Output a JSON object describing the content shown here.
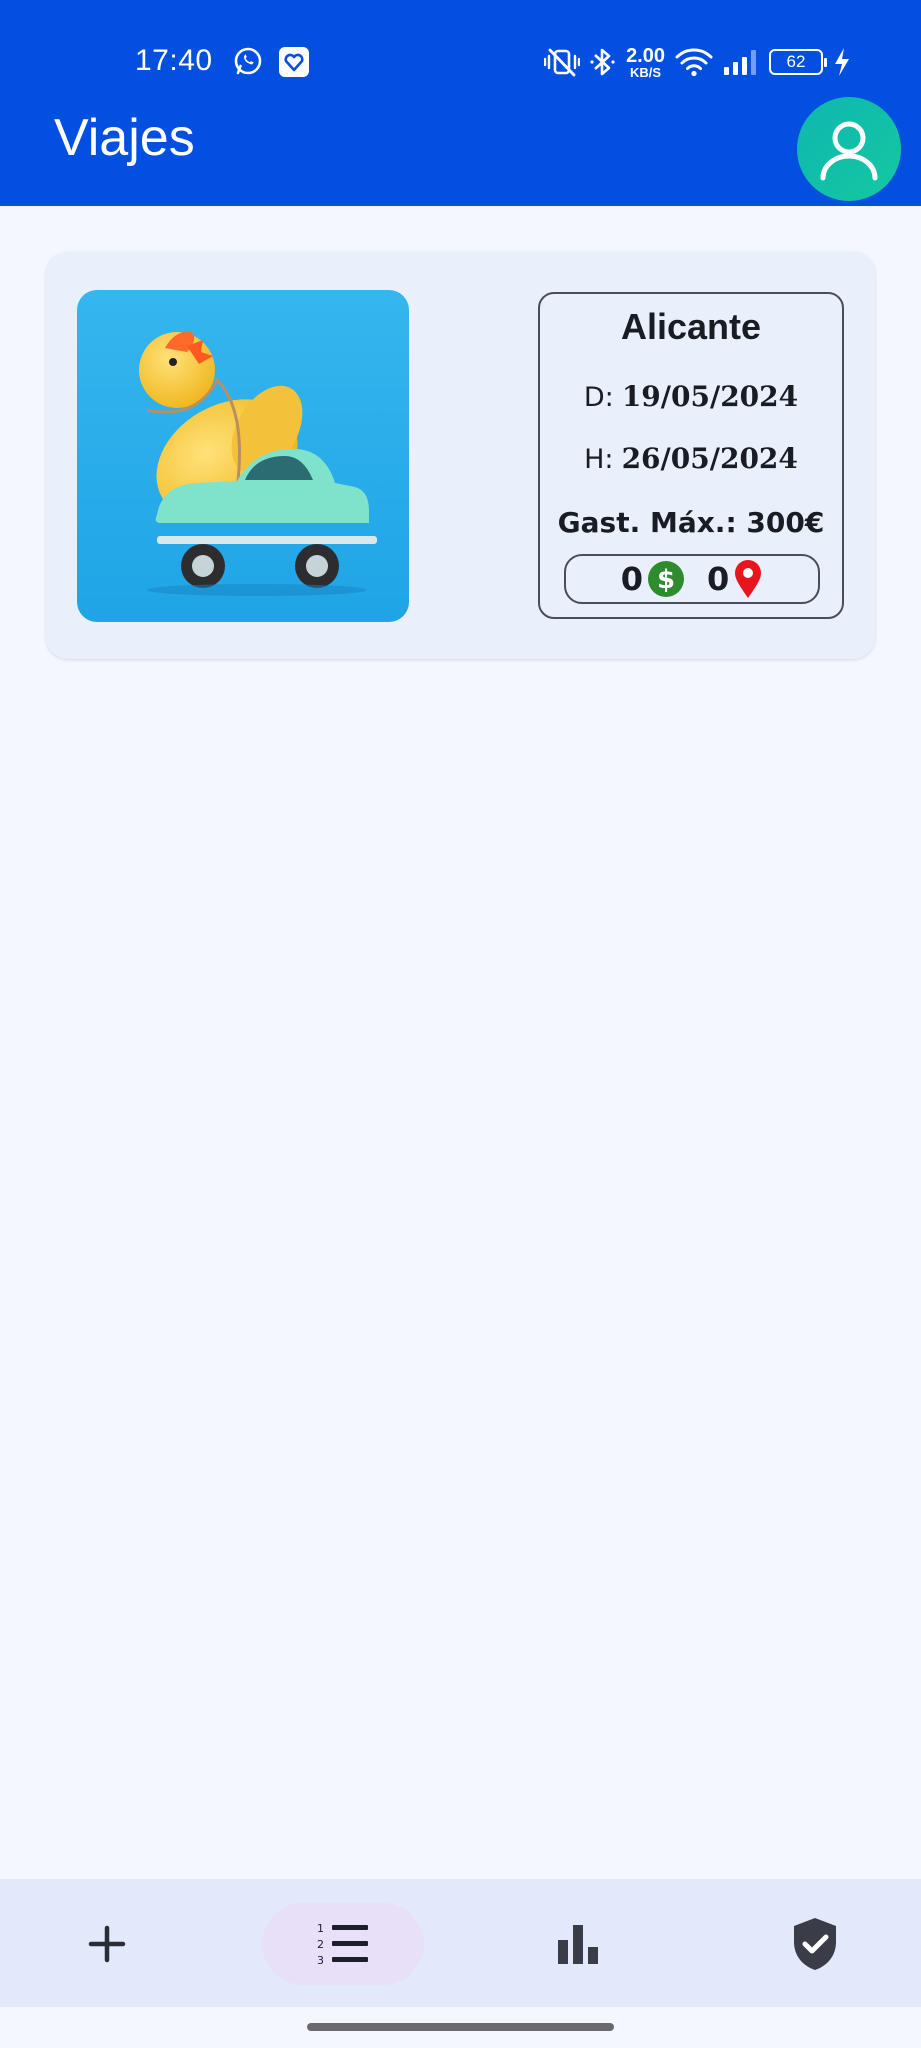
{
  "status_bar": {
    "time": "17:40",
    "speed_value": "2.00",
    "speed_unit": "KB/S",
    "battery": "62",
    "icons": [
      "whatsapp-icon",
      "app-notification-icon",
      "mute-vibrate-icon",
      "bluetooth-icon",
      "wifi-icon",
      "signal-icon",
      "charging-icon"
    ]
  },
  "app_bar": {
    "title": "Viajes",
    "avatar_icon": "user-icon"
  },
  "trips": [
    {
      "city": "Alicante",
      "from_label": "D:",
      "from_date": "19/05/2024",
      "to_label": "H:",
      "to_date": "26/05/2024",
      "budget_label": "Gast. Máx.: 300€",
      "expenses_count": "0",
      "places_count": "0",
      "image_icon": "duck-on-car-photo"
    }
  ],
  "bottom_nav": {
    "items": [
      {
        "name": "add",
        "icon": "plus-icon"
      },
      {
        "name": "list",
        "icon": "numbered-list-icon",
        "selected": true
      },
      {
        "name": "stats",
        "icon": "bar-chart-icon"
      },
      {
        "name": "privacy",
        "icon": "shield-check-icon"
      }
    ]
  },
  "colors": {
    "header": "#0350e0",
    "background": "#f4f7fe",
    "card": "#e9f0fc",
    "nav": "#e1e9fb",
    "nav_selected": "#e7e0f8",
    "money_green": "#2e8b2e",
    "pin_red": "#e8141e"
  }
}
